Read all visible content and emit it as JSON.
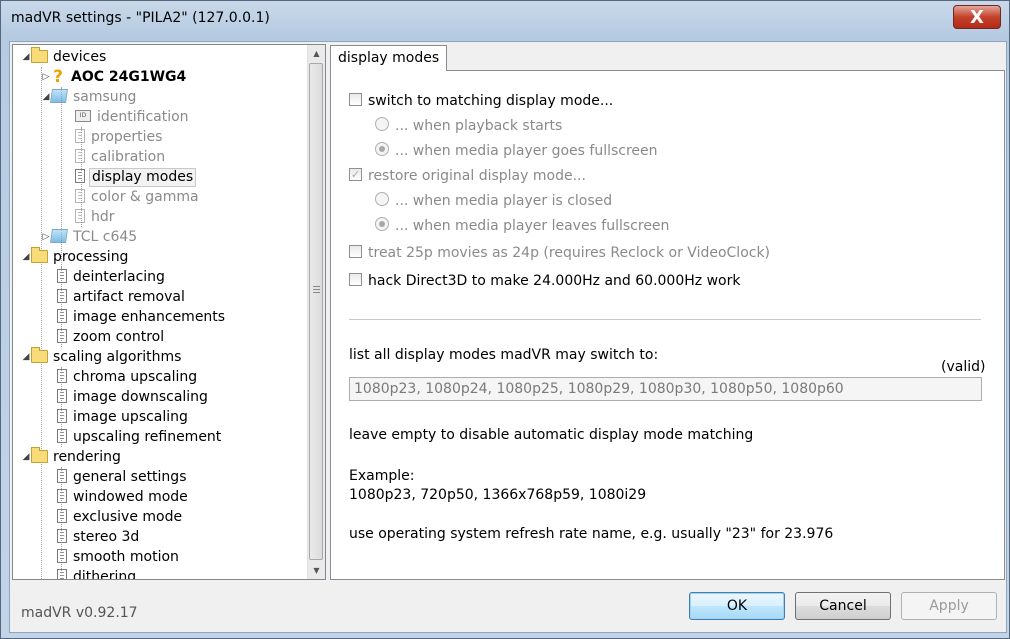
{
  "window": {
    "title": "madVR settings - \"PILA2\" (127.0.0.1)",
    "close_glyph": "X"
  },
  "tree": {
    "items": [
      {
        "label": "devices"
      },
      {
        "label": "AOC 24G1WG4"
      },
      {
        "label": "samsung"
      },
      {
        "label": "identification"
      },
      {
        "label": "properties"
      },
      {
        "label": "calibration"
      },
      {
        "label": "display modes"
      },
      {
        "label": "color & gamma"
      },
      {
        "label": "hdr"
      },
      {
        "label": "TCL c645"
      },
      {
        "label": "processing"
      },
      {
        "label": "deinterlacing"
      },
      {
        "label": "artifact removal"
      },
      {
        "label": "image enhancements"
      },
      {
        "label": "zoom control"
      },
      {
        "label": "scaling algorithms"
      },
      {
        "label": "chroma upscaling"
      },
      {
        "label": "image downscaling"
      },
      {
        "label": "image upscaling"
      },
      {
        "label": "upscaling refinement"
      },
      {
        "label": "rendering"
      },
      {
        "label": "general settings"
      },
      {
        "label": "windowed mode"
      },
      {
        "label": "exclusive mode"
      },
      {
        "label": "stereo 3d"
      },
      {
        "label": "smooth motion"
      },
      {
        "label": "dithering"
      }
    ]
  },
  "tab": {
    "label": "display modes"
  },
  "options": {
    "switch_matching": "switch to matching display mode...",
    "when_playback_starts": "... when playback starts",
    "when_fullscreen": "... when media player goes fullscreen",
    "restore_original": "restore original display mode...",
    "when_closed": "... when media player is closed",
    "when_leaves_fullscreen": "... when media player leaves fullscreen",
    "treat_25p": "treat 25p movies as 24p  (requires Reclock or VideoClock)",
    "hack_direct3d": "hack Direct3D to make 24.000Hz and 60.000Hz work"
  },
  "modes": {
    "label": "list all display modes madVR may switch to:",
    "valid": "(valid)",
    "value": "1080p23, 1080p24, 1080p25, 1080p29, 1080p30, 1080p50, 1080p60",
    "hint_empty": "leave empty to disable automatic display mode matching",
    "example_label": "Example:",
    "example_value": "1080p23, 720p50, 1366x768p59, 1080i29",
    "hint_os": "use operating system refresh rate name, e.g. usually \"23\" for 23.976"
  },
  "footer": {
    "version": "madVR v0.92.17",
    "ok": "OK",
    "cancel": "Cancel",
    "apply": "Apply"
  }
}
